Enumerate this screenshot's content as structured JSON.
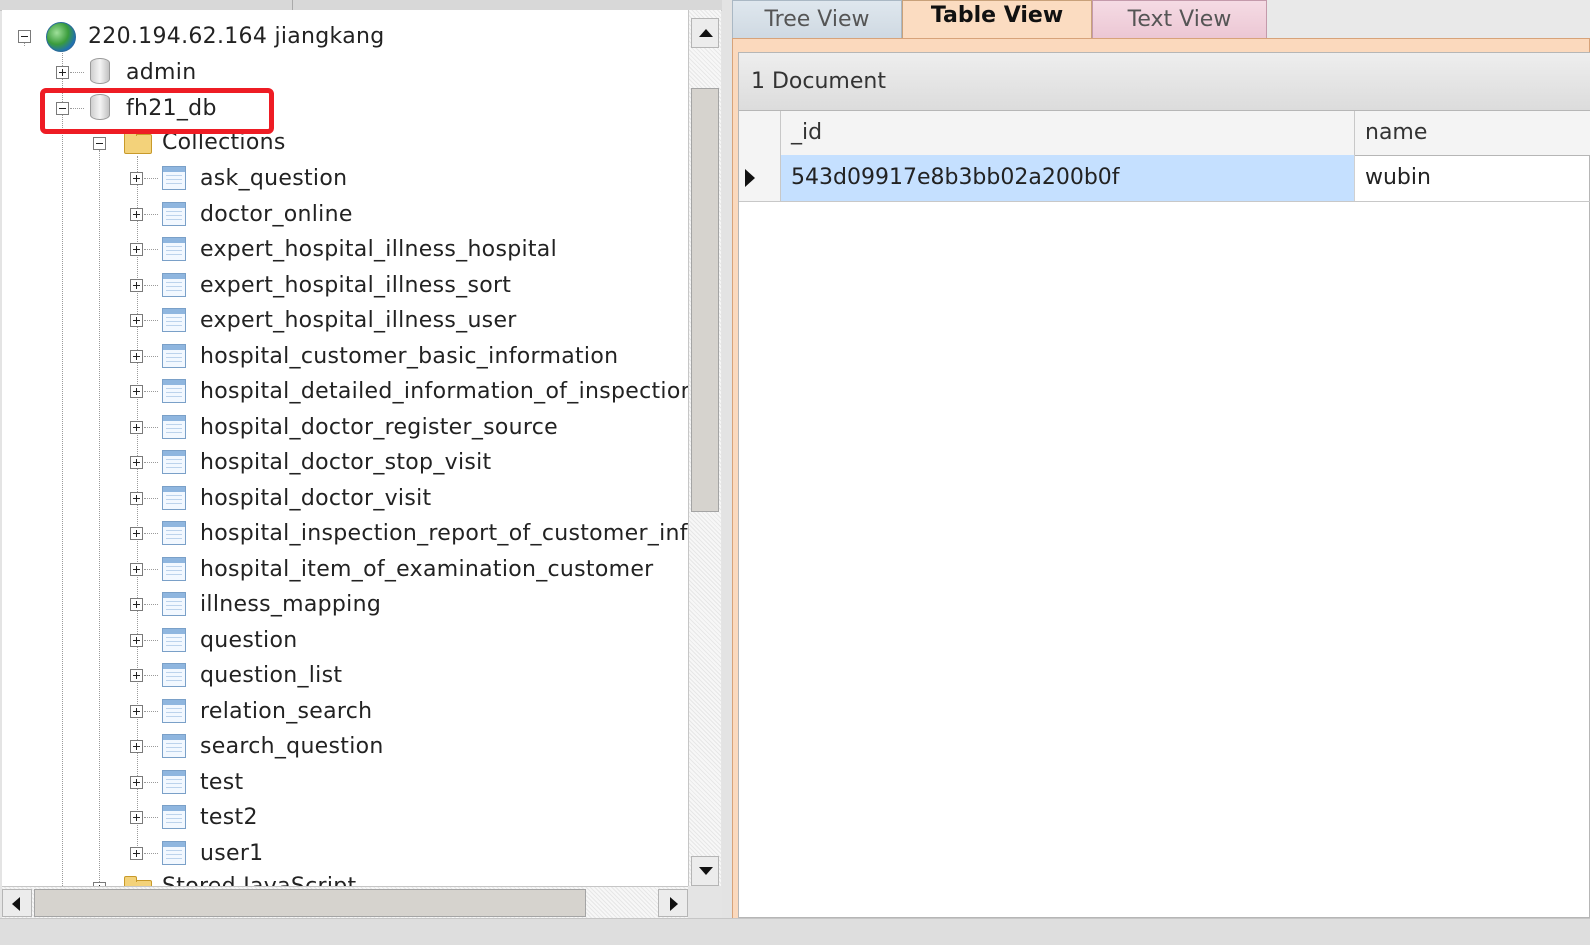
{
  "tree": {
    "server_label": "220.194.62.164 jiangkang",
    "databases": [
      {
        "label": "admin"
      },
      {
        "label": "fh21_db"
      }
    ],
    "collections_label": "Collections",
    "collections": [
      "ask_question",
      "doctor_online",
      "expert_hospital_illness_hospital",
      "expert_hospital_illness_sort",
      "expert_hospital_illness_user",
      "hospital_customer_basic_information",
      "hospital_detailed_information_of_inspection_",
      "hospital_doctor_register_source",
      "hospital_doctor_stop_visit",
      "hospital_doctor_visit",
      "hospital_inspection_report_of_customer_info",
      "hospital_item_of_examination_customer",
      "illness_mapping",
      "question",
      "question_list",
      "relation_search",
      "search_question",
      "test",
      "test2",
      "user1"
    ],
    "stored_js_label": "Stored JavaScript"
  },
  "tabs": {
    "tree_view": "Tree View",
    "table_view": "Table View",
    "text_view": "Text View",
    "active": "table_view"
  },
  "results": {
    "document_count": "1 Document",
    "columns": [
      "_id",
      "name"
    ],
    "rows": [
      {
        "_id": "543d09917e8b3bb02a200b0f",
        "name": "wubin"
      }
    ]
  },
  "colors": {
    "highlight_box": "#ee1c24",
    "selected_cell": "#c5e0ff",
    "active_tab": "#fbdcc1"
  }
}
